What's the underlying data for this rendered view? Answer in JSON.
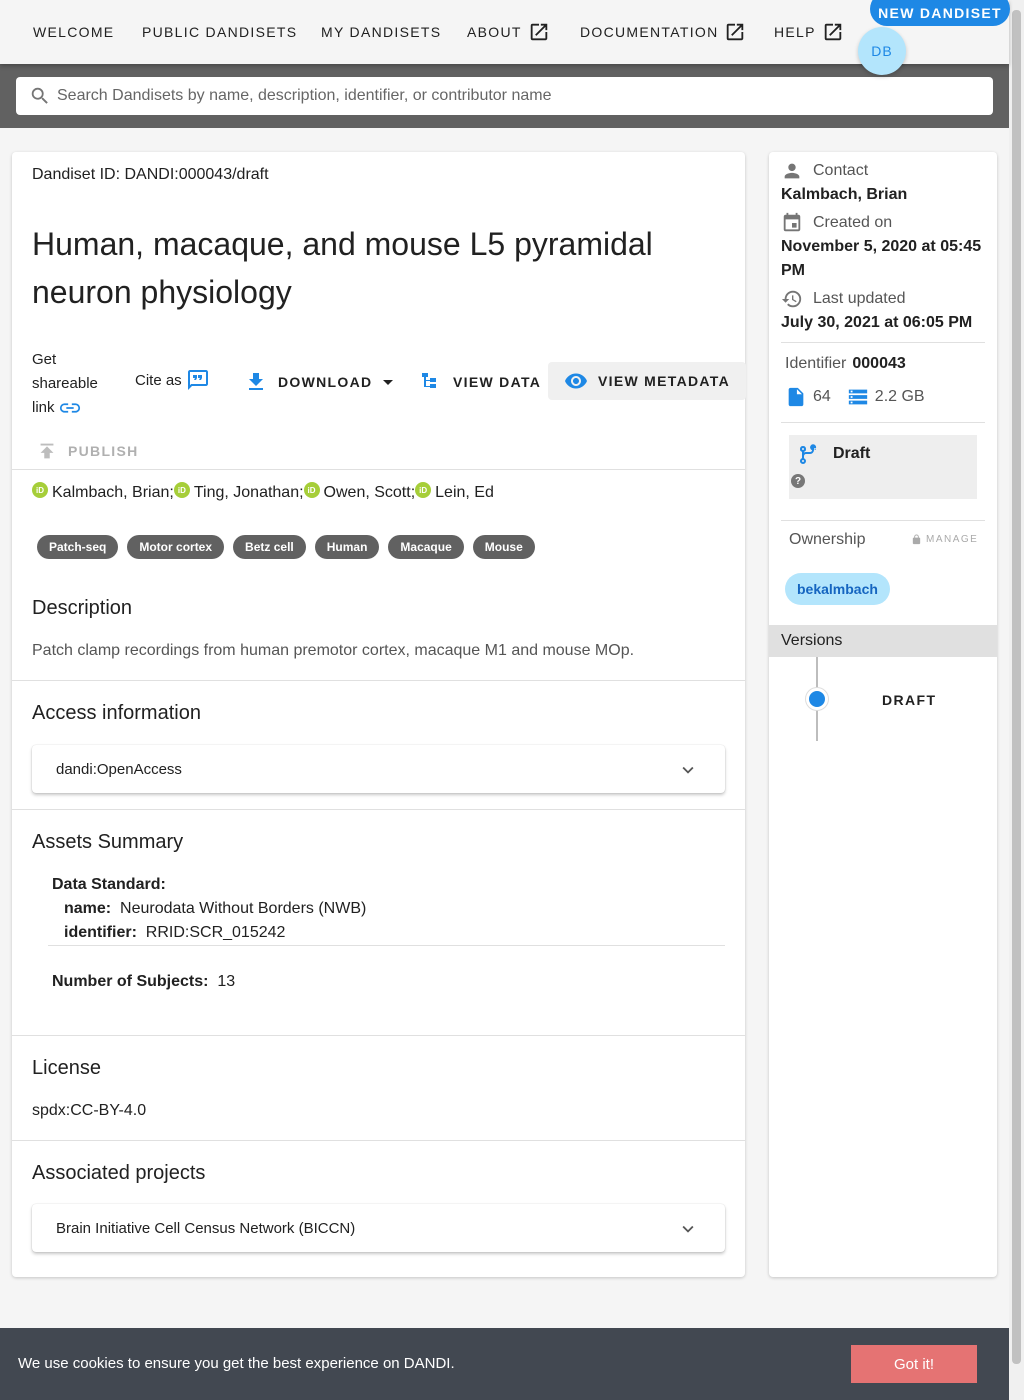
{
  "nav": {
    "welcome": "WELCOME",
    "public_dandisets": "PUBLIC DANDISETS",
    "my_dandisets": "MY DANDISETS",
    "about": "ABOUT",
    "documentation": "DOCUMENTATION",
    "help": "HELP",
    "new_dandiset": "NEW DANDISET",
    "avatar_initials": "DB"
  },
  "search": {
    "placeholder": "Search Dandisets by name, description, identifier, or contributor name"
  },
  "dandiset": {
    "id_label": "Dandiset ID: DANDI:000043/draft",
    "title": "Human, macaque, and mouse L5 pyramidal neuron physiology",
    "actions": {
      "share": "Get shareable link",
      "cite": "Cite as",
      "download": "DOWNLOAD",
      "view_data": "VIEW DATA",
      "view_metadata": "VIEW METADATA",
      "publish": "PUBLISH"
    },
    "contributors": [
      "Kalmbach, Brian;",
      "Ting, Jonathan;",
      "Owen, Scott;",
      "Lein, Ed"
    ],
    "keywords": [
      "Patch-seq",
      "Motor cortex",
      "Betz cell",
      "Human",
      "Macaque",
      "Mouse"
    ],
    "description_title": "Description",
    "description": "Patch clamp recordings from human premotor cortex, macaque M1 and mouse MOp.",
    "access_title": "Access information",
    "access_value": "dandi:OpenAccess",
    "assets_title": "Assets Summary",
    "assets": {
      "data_standard_label": "Data Standard:",
      "name_label": "name:",
      "name_value": "Neurodata Without Borders (NWB)",
      "identifier_label": "identifier:",
      "identifier_value": "RRID:SCR_015242",
      "subjects_label": "Number of Subjects:",
      "subjects_value": "13"
    },
    "license_title": "License",
    "license_value": "spdx:CC-BY-4.0",
    "projects_title": "Associated projects",
    "project_value": "Brain Initiative Cell Census Network (BICCN)"
  },
  "sidebar": {
    "contact_label": "Contact",
    "contact_value": "Kalmbach, Brian",
    "created_label": "Created on",
    "created_value": "November 5, 2020 at 05:45 PM",
    "updated_label": "Last updated",
    "updated_value": "July 30, 2021 at 06:05 PM",
    "identifier_label": "Identifier",
    "identifier_value": "000043",
    "file_count": "64",
    "size": "2.2 GB",
    "draft_label": "Draft",
    "help_mark": "?",
    "ownership_label": "Ownership",
    "manage_label": "MANAGE",
    "owner": "bekalmbach",
    "versions_label": "Versions",
    "version_item": "DRAFT"
  },
  "cookie": {
    "text": "We use cookies to ensure you get the best experience on DANDI.",
    "button": "Got it!"
  },
  "colors": {
    "primary": "#1e88e5",
    "chip_bg": "#b3e5fc",
    "keyword_bg": "#616161",
    "cookie_bg": "#424851",
    "cookie_button": "#e57373",
    "orcid": "#a6ce39"
  }
}
